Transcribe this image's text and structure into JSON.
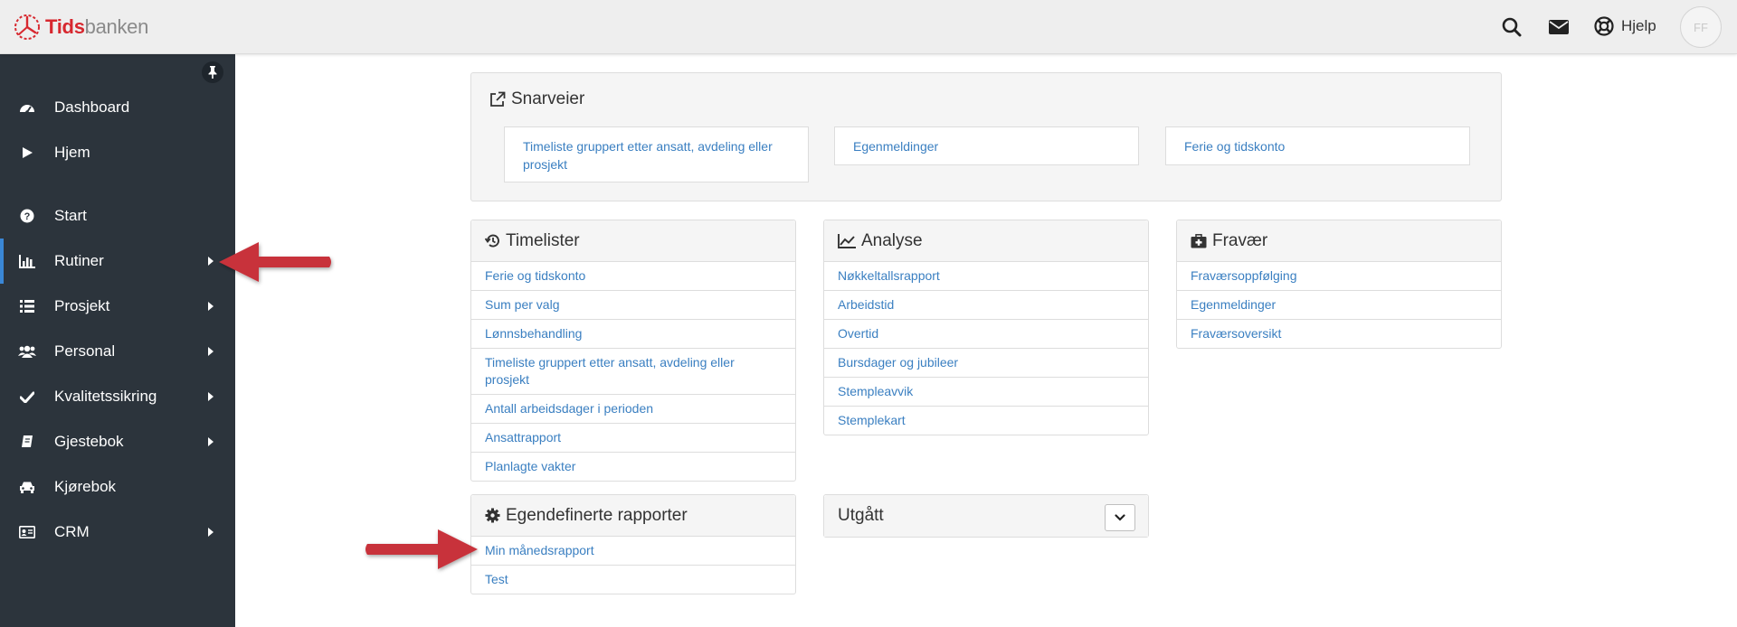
{
  "header": {
    "logo_red": "Tids",
    "logo_gray": "banken",
    "help_label": "Hjelp",
    "avatar_initials": "FF"
  },
  "sidebar": {
    "items": [
      {
        "label": "Dashboard",
        "icon": "dashboard-icon",
        "has_submenu": false
      },
      {
        "label": "Hjem",
        "icon": "play-icon",
        "has_submenu": false
      },
      {
        "label": "Start",
        "icon": "question-circle-icon",
        "has_submenu": false
      },
      {
        "label": "Rutiner",
        "icon": "bar-chart-icon",
        "has_submenu": true,
        "active": true
      },
      {
        "label": "Prosjekt",
        "icon": "list-icon",
        "has_submenu": true
      },
      {
        "label": "Personal",
        "icon": "users-icon",
        "has_submenu": true
      },
      {
        "label": "Kvalitetssikring",
        "icon": "check-icon",
        "has_submenu": true
      },
      {
        "label": "Gjestebok",
        "icon": "book-icon",
        "has_submenu": true
      },
      {
        "label": "Kjørebok",
        "icon": "car-icon",
        "has_submenu": false
      },
      {
        "label": "CRM",
        "icon": "id-card-icon",
        "has_submenu": true
      }
    ]
  },
  "shortcuts": {
    "title": "Snarveier",
    "items": [
      "Timeliste gruppert etter ansatt, avdeling eller prosjekt",
      "Egenmeldinger",
      "Ferie og tidskonto"
    ]
  },
  "timelister": {
    "title": "Timelister",
    "items": [
      "Ferie og tidskonto",
      "Sum per valg",
      "Lønnsbehandling",
      "Timeliste gruppert etter ansatt, avdeling eller prosjekt",
      "Antall arbeidsdager i perioden",
      "Ansattrapport",
      "Planlagte vakter"
    ]
  },
  "analyse": {
    "title": "Analyse",
    "items": [
      "Nøkkeltallsrapport",
      "Arbeidstid",
      "Overtid",
      "Bursdager og jubileer",
      "Stempleavvik",
      "Stemplekart"
    ]
  },
  "fravaer": {
    "title": "Fravær",
    "items": [
      "Fraværsoppfølging",
      "Egenmeldinger",
      "Fraværsoversikt"
    ]
  },
  "custom_reports": {
    "title": "Egendefinerte rapporter",
    "items": [
      "Min månedsrapport",
      "Test"
    ]
  },
  "utgatt": {
    "title": "Utgått"
  },
  "colors": {
    "brand_red": "#d7282f",
    "sidebar_bg": "#2c343c",
    "active_accent": "#3a87d6",
    "link": "#3a7fc1",
    "arrow_red": "#c8313a"
  }
}
